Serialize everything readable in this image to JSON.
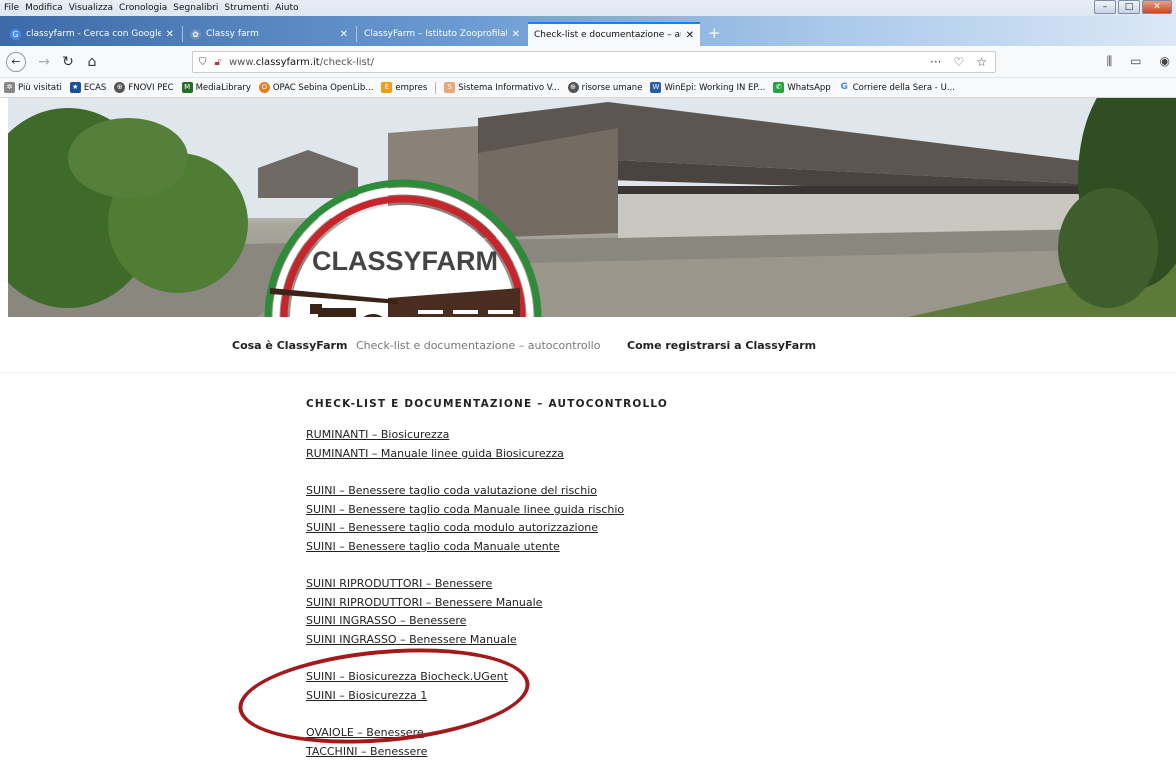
{
  "menubar": {
    "items": [
      "File",
      "Modifica",
      "Visualizza",
      "Cronologia",
      "Segnalibri",
      "Strumenti",
      "Aiuto"
    ]
  },
  "tabs": [
    {
      "label": "classyfarm - Cerca con Google",
      "icon": "google-icon"
    },
    {
      "label": "Classy farm",
      "icon": "site-icon"
    },
    {
      "label": "ClassyFarm – Istituto Zooprofilattic",
      "icon": "none"
    },
    {
      "label": "Check-list e documentazione – aut",
      "icon": "none",
      "active": true
    }
  ],
  "address_bar": {
    "url_prefix": "www.",
    "url_domain": "classyfarm.it",
    "url_path": "/check-list/",
    "more": "···"
  },
  "bookmarks": [
    {
      "label": "Più visitati",
      "icon": "gear-icon",
      "color": "#777777"
    },
    {
      "label": "ECAS",
      "icon": "eu-icon",
      "color": "#1b4f9c"
    },
    {
      "label": "FNOVI PEC",
      "icon": "globe-icon",
      "color": "#555555"
    },
    {
      "label": "MediaLibrary",
      "icon": "ml-icon",
      "color": "#2a6b2a"
    },
    {
      "label": "OPAC Sebina OpenLib...",
      "icon": "opac-icon",
      "color": "#e67e22"
    },
    {
      "label": "empres",
      "icon": "empres-icon",
      "color": "#f39c12"
    },
    {
      "label": "Sistema Informativo V...",
      "icon": "siv-icon",
      "color": "#e8a87c"
    },
    {
      "label": "risorse umane",
      "icon": "globe-icon",
      "color": "#555555"
    },
    {
      "label": "WinEpi: Working IN EP...",
      "icon": "winepi-icon",
      "color": "#2a5caa"
    },
    {
      "label": "WhatsApp",
      "icon": "whatsapp-icon",
      "color": "#25a244"
    },
    {
      "label": "Corriere della Sera - U...",
      "icon": "google-icon",
      "color": "#4285f4"
    }
  ],
  "logo": {
    "text": "CLASSYFARM"
  },
  "site_nav": {
    "item1": "Cosa è ClassyFarm",
    "item2": "Check-list e documentazione – autocontrollo",
    "item3": "Come registrarsi a ClassyFarm"
  },
  "page": {
    "heading": "CHECK-LIST E DOCUMENTAZIONE – AUTOCONTROLLO",
    "groups": [
      [
        "RUMINANTI – Biosicurezza",
        "RUMINANTI – Manuale linee guida Biosicurezza"
      ],
      [
        "SUINI – Benessere taglio coda valutazione del rischio",
        "SUINI – Benessere taglio coda Manuale linee guida rischio",
        "SUINI – Benessere taglio coda modulo autorizzazione",
        "SUINI – Benessere taglio coda Manuale utente"
      ],
      [
        "SUINI RIPRODUTTORI – Benessere",
        "SUINI RIPRODUTTORI – Benessere  Manuale",
        "SUINI INGRASSO – Benessere",
        "SUINI INGRASSO – Benessere Manuale"
      ],
      [
        "SUINI – Biosicurezza Biocheck.UGent",
        "SUINI – Biosicurezza 1"
      ],
      [
        "OVAIOLE – Benessere",
        "TACCHINI – Benessere"
      ]
    ]
  },
  "colors": {
    "highlight": "#a4191c",
    "tab_accent": "#0a84ff"
  }
}
